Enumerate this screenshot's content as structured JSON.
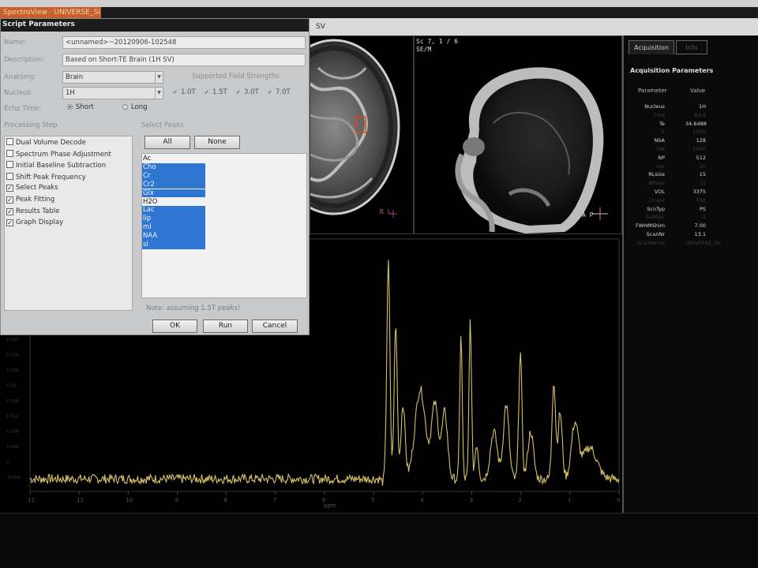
{
  "app": {
    "tab_label": "SpectroView · UNIVERSE_SI"
  },
  "viewer": {
    "label": "SV",
    "sagittal_label_line1": "Sc 7, 1 / 6",
    "sagittal_label_line2": "SE/M",
    "orient_axial": "R  L",
    "orient_sagittal": "A   P"
  },
  "dialog": {
    "title": "Script Parameters",
    "labels": {
      "name": "Name:",
      "description": "Description:",
      "anatomy": "Anatomy:",
      "nucleus": "Nucleus:",
      "echo_time": "Echo Time:",
      "supported_field": "Supported Field Strengths",
      "processing_step": "Processing Step",
      "select_peaks": "Select Peaks"
    },
    "name_value": "<unnamed>~20120906-102548",
    "description_value": "Based on Short-TE Brain (1H SV)",
    "anatomy_value": "Brain",
    "nucleus_value": "1H",
    "echo_options": [
      {
        "label": "Short",
        "selected": true
      },
      {
        "label": "Long",
        "selected": false
      }
    ],
    "field_strengths": [
      {
        "label": "1.0T",
        "checked": true
      },
      {
        "label": "1.5T",
        "checked": true
      },
      {
        "label": "3.0T",
        "checked": true
      },
      {
        "label": "7.0T",
        "checked": true
      }
    ],
    "steps": [
      {
        "label": "Dual Volume Decode",
        "checked": false
      },
      {
        "label": "Spectrum Phase Adjustment",
        "checked": false
      },
      {
        "label": "Initial Baseline Subtraction",
        "checked": false
      },
      {
        "label": "Shift Peak Frequency",
        "checked": false
      },
      {
        "label": "Select Peaks",
        "checked": true
      },
      {
        "label": "Peak Fitting",
        "checked": true
      },
      {
        "label": "Results Table",
        "checked": true
      },
      {
        "label": "Graph Display",
        "checked": true
      }
    ],
    "peaks_all_label": "All",
    "peaks_none_label": "None",
    "peaks": [
      {
        "label": "Ac",
        "selected": false
      },
      {
        "label": "Cho",
        "selected": true
      },
      {
        "label": "Cr",
        "selected": true
      },
      {
        "label": "Cr2",
        "selected": true
      },
      {
        "label": "Glx",
        "selected": true
      },
      {
        "label": "H2O",
        "selected": false
      },
      {
        "label": "Lac",
        "selected": true
      },
      {
        "label": "lip",
        "selected": true
      },
      {
        "label": "ml",
        "selected": true
      },
      {
        "label": "NAA",
        "selected": true
      },
      {
        "label": "sI",
        "selected": true
      }
    ],
    "note": "Note: assuming 1.5T peaks!",
    "ok_label": "OK",
    "run_label": "Run",
    "cancel_label": "Cancel"
  },
  "acquisition": {
    "tab_label": "Acquisition",
    "other_tab_label": "Info",
    "title": "Acquisition Parameters",
    "col_param": "Parameter",
    "col_value": "Value",
    "rows": [
      {
        "k": "Nucleus",
        "v": "1H",
        "bright": true
      },
      {
        "k": "Freq",
        "v": "63.6",
        "bright": false
      },
      {
        "k": "Te",
        "v": "34.6488",
        "bright": true
      },
      {
        "k": "Tr",
        "v": "1500",
        "bright": false
      },
      {
        "k": "NSA",
        "v": "128",
        "bright": true
      },
      {
        "k": "SW",
        "v": "1000",
        "bright": false
      },
      {
        "k": "NP",
        "v": "512",
        "bright": true
      },
      {
        "k": "Vox",
        "v": "20",
        "bright": false
      },
      {
        "k": "RLsize",
        "v": "15",
        "bright": true
      },
      {
        "k": "APsize",
        "v": "15",
        "bright": false
      },
      {
        "k": "VOL",
        "v": "3375",
        "bright": true
      },
      {
        "k": "Orient",
        "v": "TRA",
        "bright": false
      },
      {
        "k": "ScnTyp",
        "v": "PS",
        "bright": true
      },
      {
        "k": "SubSpc",
        "v": "1",
        "bright": false
      },
      {
        "k": "FWHMShim",
        "v": "7.00",
        "bright": true
      },
      {
        "k": "ScanNr",
        "v": "13.1",
        "bright": true
      },
      {
        "k": "ScanName",
        "v": "UNIVERSE_SV",
        "bright": false
      }
    ]
  },
  "chart_data": {
    "type": "line",
    "xlabel": "ppm",
    "ylabel": "",
    "xlim": [
      12,
      0
    ],
    "ylim": [
      -0.02,
      0.14
    ],
    "x_ticks": [
      "12",
      "11",
      "10",
      "9",
      "8",
      "7",
      "6",
      "5",
      "4",
      "3",
      "2",
      "1",
      "0"
    ],
    "y_ticks": [
      "-0.004",
      "0",
      "0.004",
      "0.008",
      "0.012",
      "0.016",
      "0.02",
      "0.024",
      "0.028",
      "0.032"
    ],
    "peaks": [
      {
        "ppm": 4.7,
        "y": 0.125,
        "w": 0.045
      },
      {
        "ppm": 4.55,
        "y": 0.085,
        "w": 0.045
      },
      {
        "ppm": 4.82,
        "y": -0.014,
        "w": 0.03
      },
      {
        "ppm": 4.4,
        "y": 0.035,
        "w": 0.06
      },
      {
        "ppm": 4.05,
        "y": 0.045,
        "w": 0.15
      },
      {
        "ppm": 3.75,
        "y": 0.035,
        "w": 0.1
      },
      {
        "ppm": 3.55,
        "y": 0.03,
        "w": 0.08
      },
      {
        "ppm": 3.22,
        "y": 0.08,
        "w": 0.035
      },
      {
        "ppm": 3.03,
        "y": 0.09,
        "w": 0.035
      },
      {
        "ppm": 2.9,
        "y": 0.01,
        "w": 0.05
      },
      {
        "ppm": 2.55,
        "y": 0.018,
        "w": 0.1
      },
      {
        "ppm": 2.3,
        "y": 0.035,
        "w": 0.08
      },
      {
        "ppm": 2.01,
        "y": 0.068,
        "w": 0.045
      },
      {
        "ppm": 1.8,
        "y": 0.018,
        "w": 0.08
      },
      {
        "ppm": 1.33,
        "y": 0.05,
        "w": 0.05
      },
      {
        "ppm": 1.2,
        "y": 0.03,
        "w": 0.06
      },
      {
        "ppm": 0.9,
        "y": 0.022,
        "w": 0.1
      },
      {
        "ppm": 0.6,
        "y": 0.008,
        "w": 0.2
      }
    ],
    "baseline": -0.012,
    "noise": 0.003,
    "line_color": "#d7c06a"
  }
}
